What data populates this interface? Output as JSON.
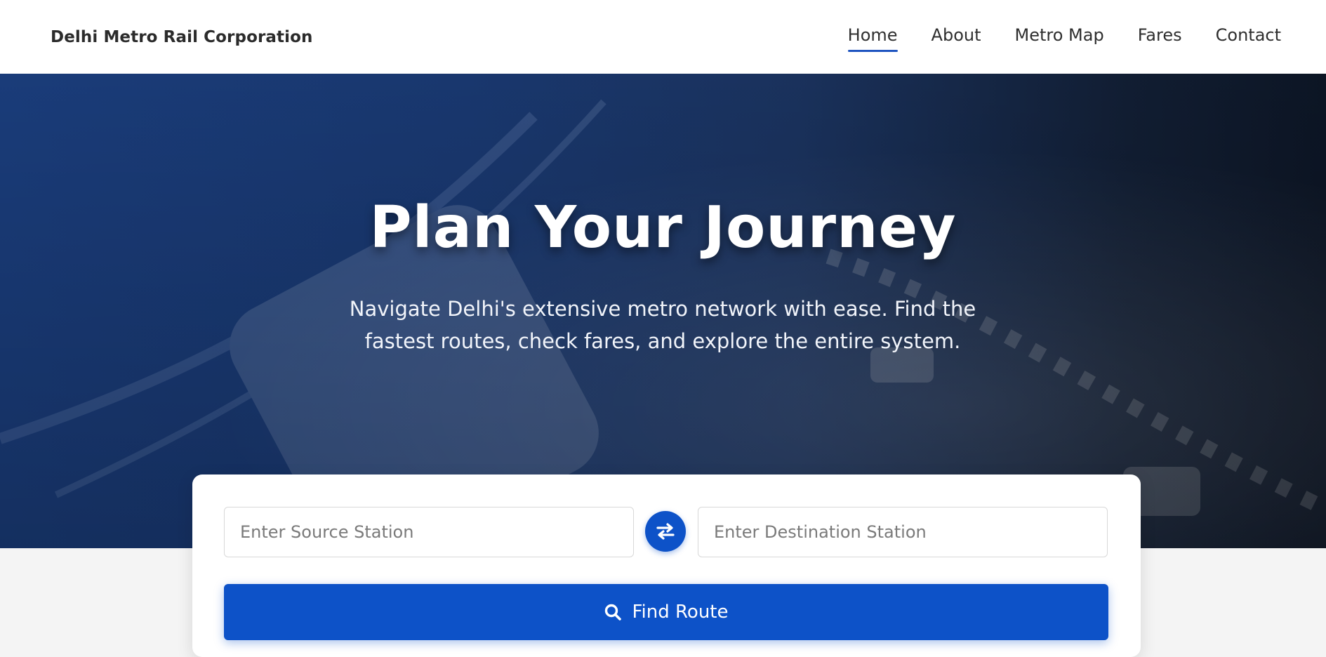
{
  "header": {
    "brand": "Delhi Metro Rail Corporation",
    "nav": [
      {
        "label": "Home",
        "active": true
      },
      {
        "label": "About",
        "active": false
      },
      {
        "label": "Metro Map",
        "active": false
      },
      {
        "label": "Fares",
        "active": false
      },
      {
        "label": "Contact",
        "active": false
      }
    ]
  },
  "hero": {
    "title": "Plan Your Journey",
    "subtitle": "Navigate Delhi's extensive metro network with ease. Find the fastest routes, check fares, and explore the entire system."
  },
  "search": {
    "source_placeholder": "Enter Source Station",
    "source_value": "",
    "destination_placeholder": "Enter Destination Station",
    "destination_value": "",
    "swap_icon": "swap-arrows-icon",
    "find_label": "Find Route",
    "find_icon": "search-icon"
  },
  "colors": {
    "primary": "#0d52c8",
    "nav_active_underline": "#1f55c0",
    "hero_overlay": "#1b3f80"
  }
}
